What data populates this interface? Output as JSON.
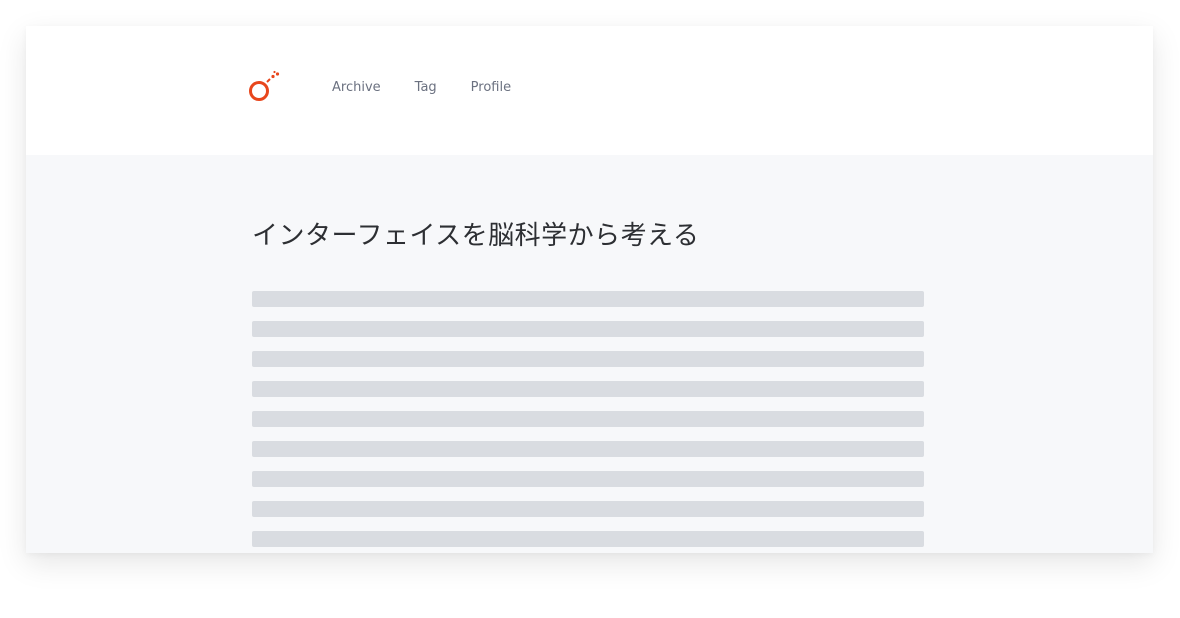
{
  "header": {
    "logo": "ring-with-sparks-logo",
    "nav": [
      {
        "label": "Archive"
      },
      {
        "label": "Tag"
      },
      {
        "label": "Profile"
      }
    ]
  },
  "article": {
    "title": "インターフェイスを脳科学から考える",
    "placeholder_lines": 9
  },
  "colors": {
    "accent": "#e8461c",
    "nav_text": "#6b7180",
    "title_text": "#2d2f33",
    "placeholder": "#d9dce1",
    "content_bg": "#f7f8fa",
    "header_bg": "#ffffff"
  }
}
